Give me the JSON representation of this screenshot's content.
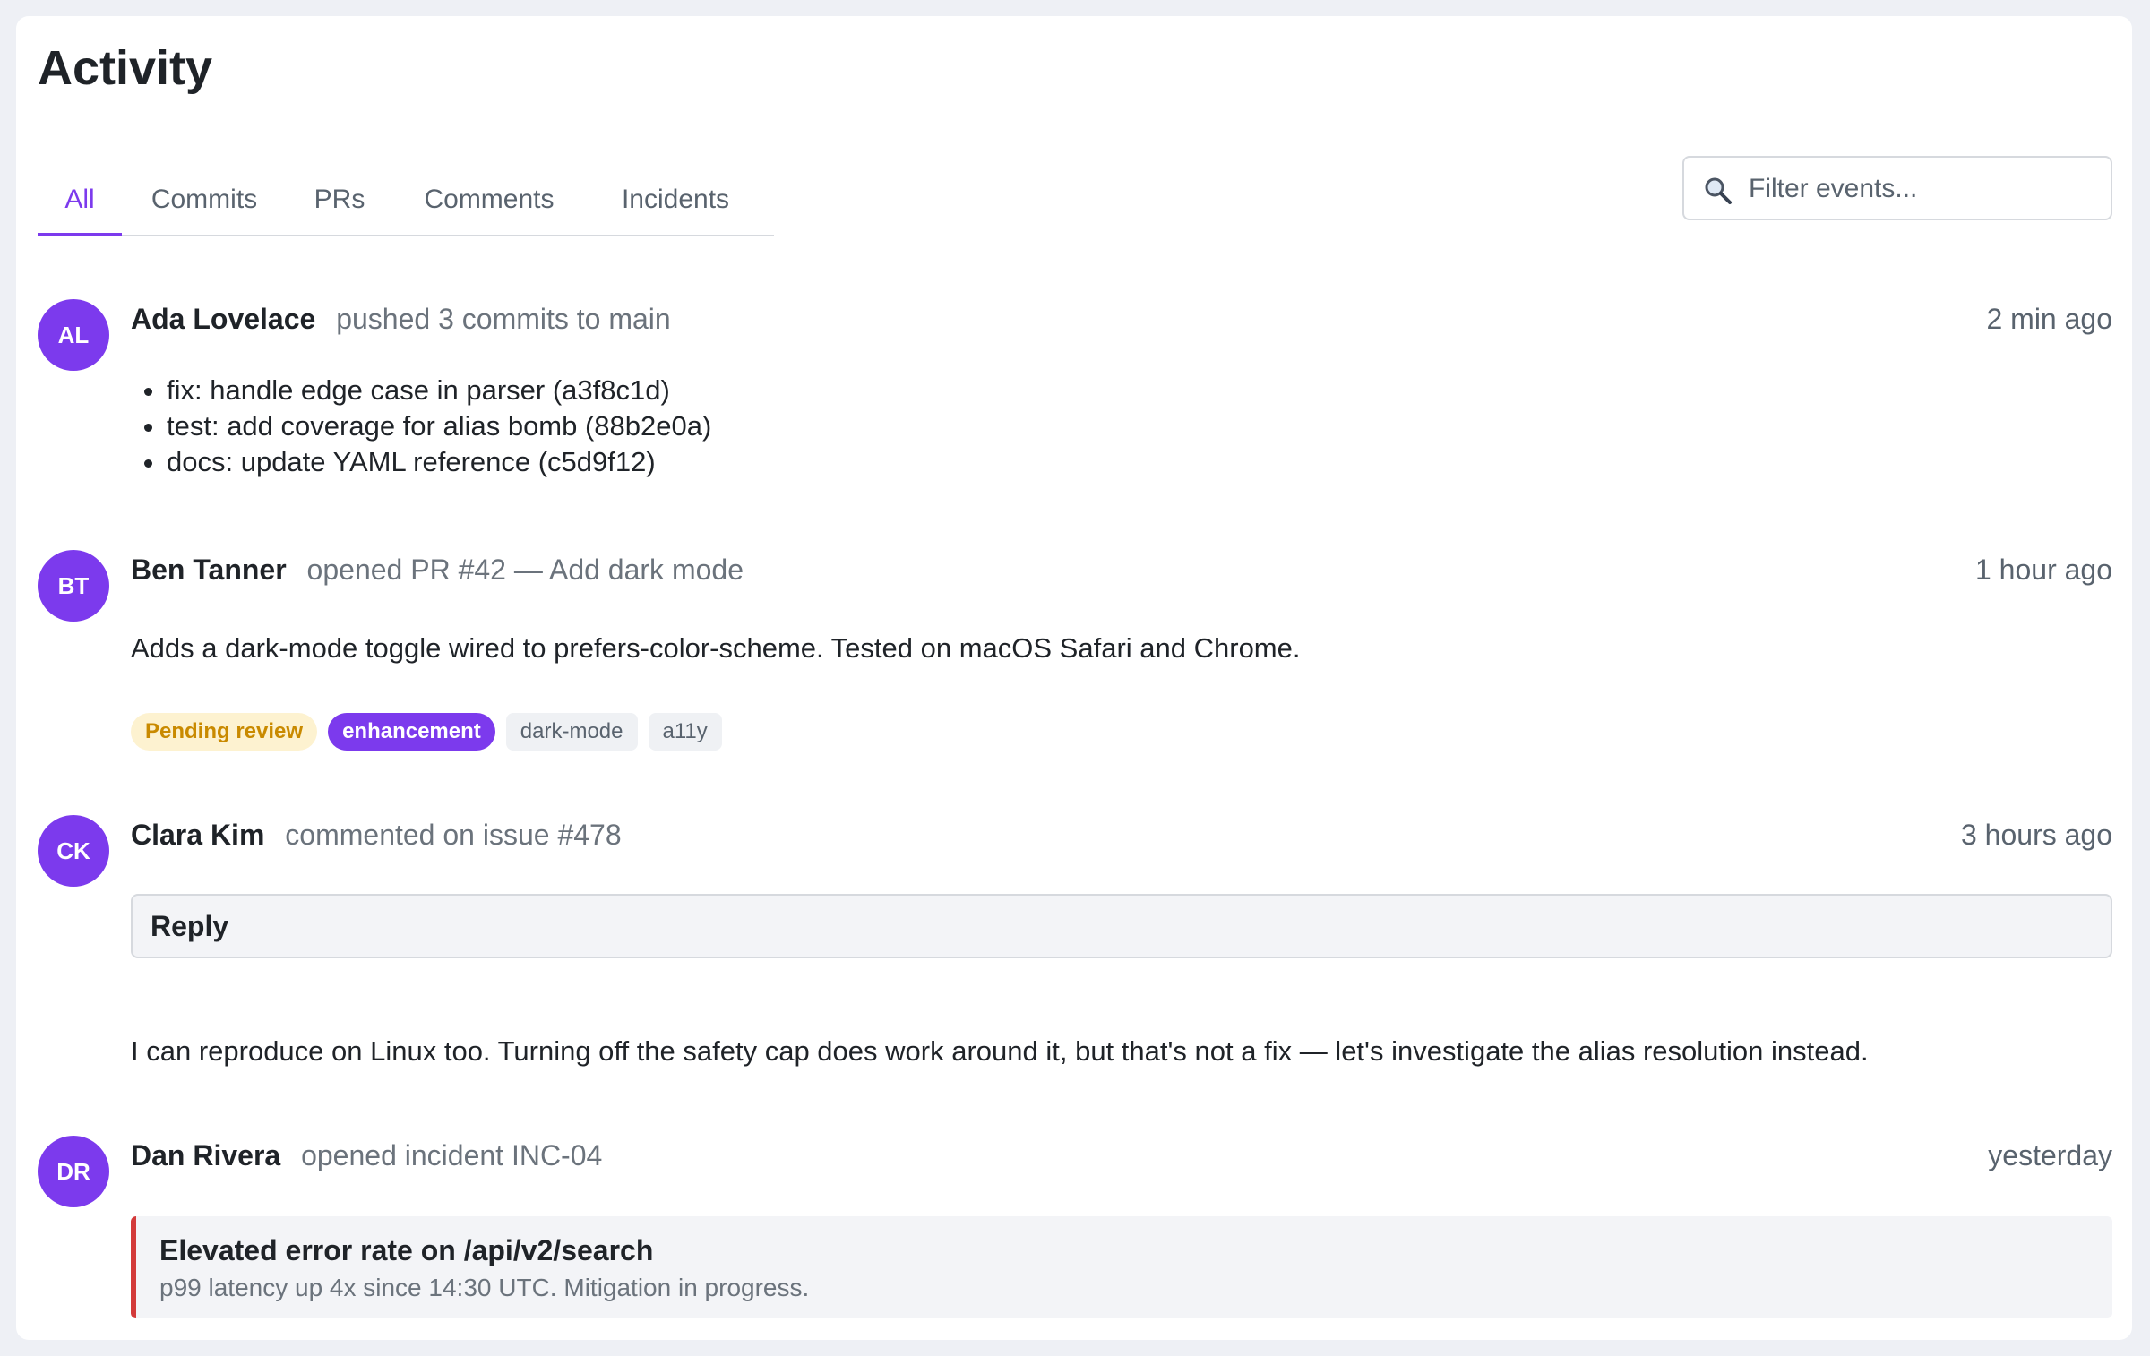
{
  "header": {
    "title": "Activity"
  },
  "tabs": [
    {
      "label": "All",
      "active": true
    },
    {
      "label": "Commits",
      "active": false
    },
    {
      "label": "PRs",
      "active": false
    },
    {
      "label": "Comments",
      "active": false
    },
    {
      "label": "Incidents",
      "active": false
    }
  ],
  "filter": {
    "placeholder": "Filter events...",
    "value": "",
    "icon": "search-icon"
  },
  "colors": {
    "accent": "#7c3aed",
    "pending": "#c98a00",
    "incident": "#d33a3a"
  },
  "events": [
    {
      "initials": "AL",
      "name": "Ada Lovelace",
      "action": "pushed 3 commits to main",
      "time": "2 min ago",
      "commits": [
        "fix: handle edge case in parser (a3f8c1d)",
        "test: add coverage for alias bomb (88b2e0a)",
        "docs: update YAML reference (c5d9f12)"
      ]
    },
    {
      "initials": "BT",
      "name": "Ben Tanner",
      "action": "opened PR #42 — Add dark mode",
      "time": "1 hour ago",
      "body": "Adds a dark-mode toggle wired to prefers-color-scheme. Tested on macOS Safari and Chrome.",
      "tags": [
        "Pending review",
        "enhancement",
        "dark-mode",
        "a11y"
      ]
    },
    {
      "initials": "CK",
      "name": "Clara Kim",
      "action": "commented on issue #478",
      "time": "3 hours ago",
      "reply_label": "Reply",
      "body": "I can reproduce on Linux too. Turning off the safety cap does work around it, but that's not a fix — let's investigate the alias resolution instead."
    },
    {
      "initials": "DR",
      "name": "Dan Rivera",
      "action": "opened incident INC-04",
      "time": "yesterday",
      "incident": {
        "title": "Elevated error rate on /api/v2/search",
        "detail": "p99 latency up 4x since 14:30 UTC. Mitigation in progress."
      }
    }
  ]
}
